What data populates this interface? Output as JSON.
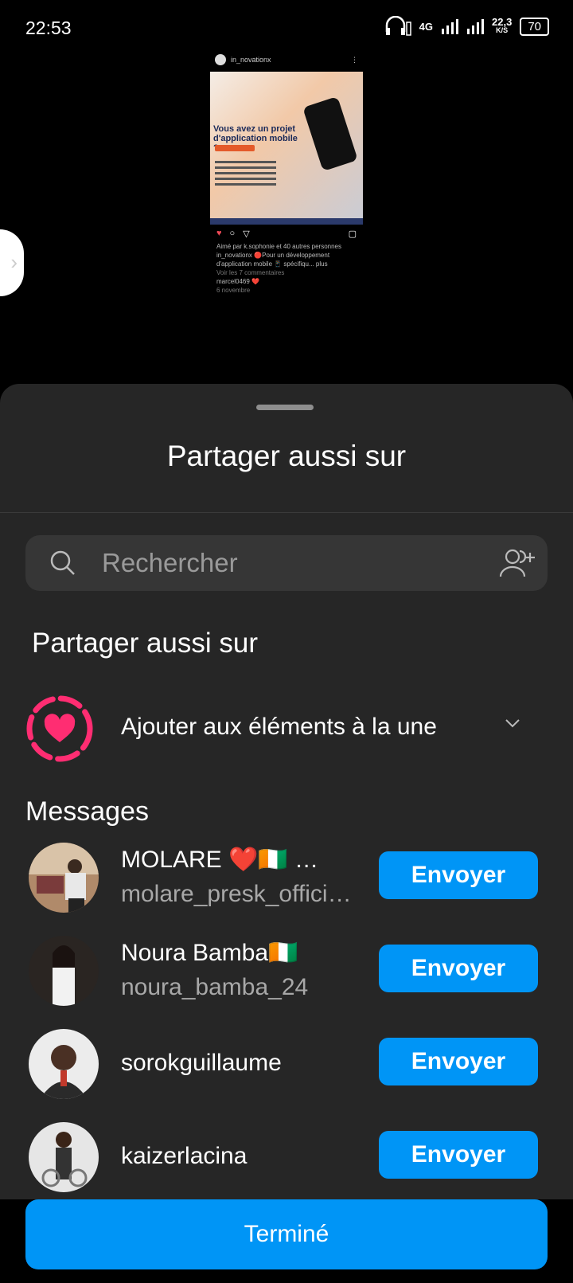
{
  "status_bar": {
    "time": "22:53",
    "network": "4G",
    "speed": "22,3",
    "speed_unit": "K/S",
    "battery": "70"
  },
  "post_preview": {
    "username": "in_novationx",
    "headline_line1": "Vous avez un projet",
    "headline_line2": "d'application mobile ?",
    "liked_by": "Aimé par k.sophonie et 40 autres personnes",
    "caption": "in_novationx 🔴Pour un développement d'application mobile 📱 spécifiqu... plus",
    "view_comments": "Voir les 7 commentaires",
    "comment": "marcel0469 ❤️",
    "date": "6 novembre"
  },
  "sheet": {
    "title": "Partager aussi sur",
    "search_placeholder": "Rechercher",
    "share_section_title": "Partager aussi sur",
    "highlight_label": "Ajouter aux éléments à la une",
    "messages_title": "Messages",
    "contacts": [
      {
        "name": "MOLARE ❤️🇨🇮     …",
        "username": "molare_presk_offici…",
        "button": "Envoyer"
      },
      {
        "name": "Noura Bamba🇨🇮",
        "username": "noura_bamba_24",
        "button": "Envoyer"
      },
      {
        "name": "sorokguillaume",
        "username": "",
        "button": "Envoyer"
      },
      {
        "name": "kaizerlacina",
        "username": "",
        "button": "Envoyer"
      }
    ],
    "done_label": "Terminé"
  },
  "colors": {
    "sheet_bg": "#262626",
    "accent_blue": "#0095f6",
    "highlight_pink": "#ff2d72"
  }
}
